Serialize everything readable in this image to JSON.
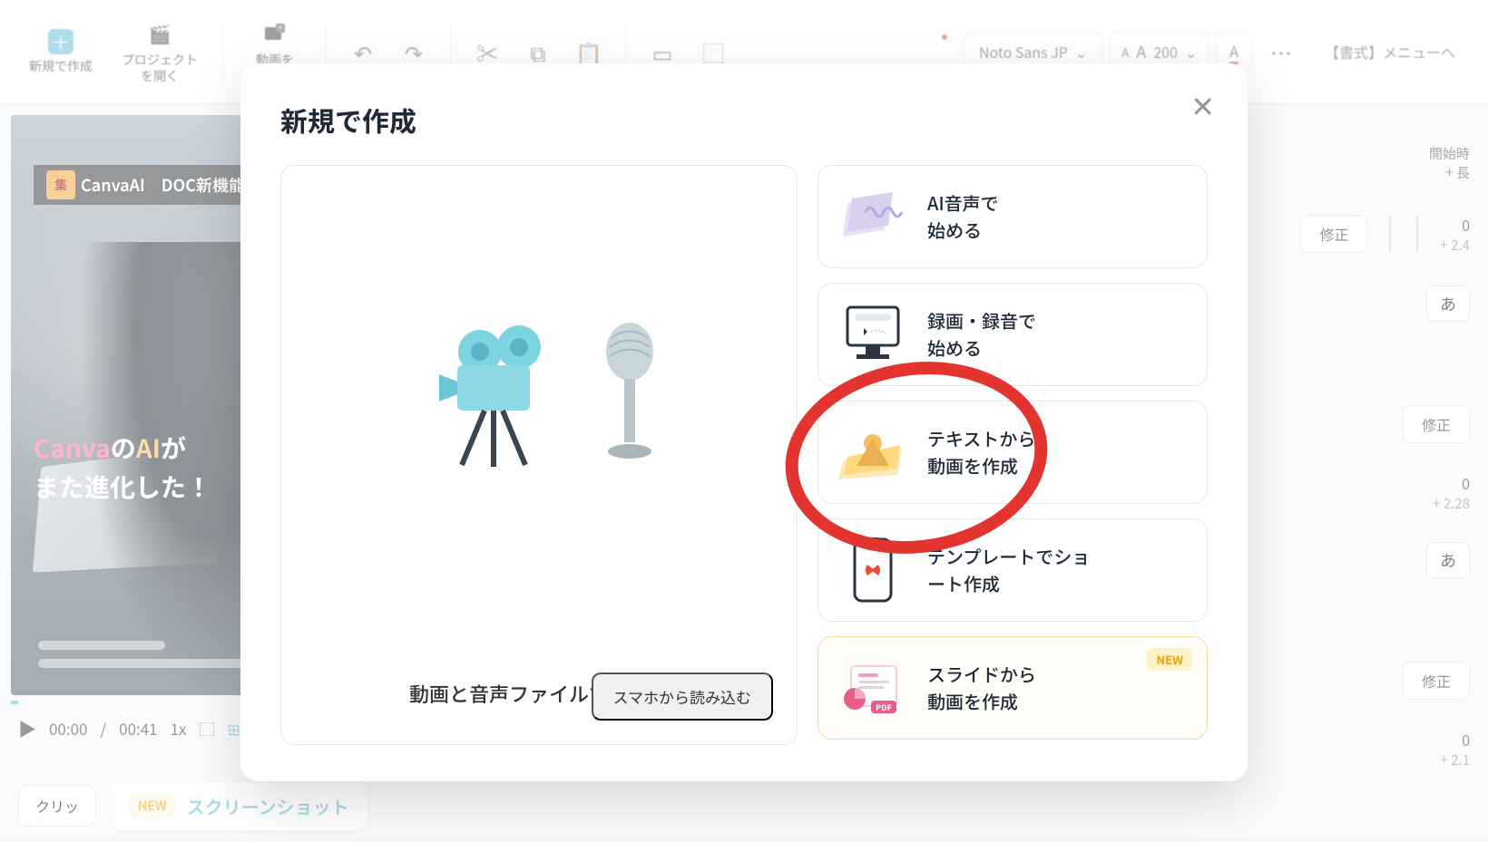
{
  "toolbar": {
    "new": "新規で作成",
    "open": "プロジェクト\nを開く",
    "add_video": "動画を\n追加する",
    "font_name": "Noto Sans JP",
    "font_size": "200",
    "format_menu": "【書式】メニューへ"
  },
  "preview": {
    "badge_title": "CanvaAI　DOC新機能",
    "caption_line1_a": "Canva",
    "caption_line1_b": "の",
    "caption_line1_c": "AI",
    "caption_line1_d": "が",
    "caption_line2": "また進化した！"
  },
  "playback": {
    "current": "00:00",
    "sep": "/",
    "total": "00:41",
    "speed": "1x"
  },
  "right": {
    "start_label": "開始時",
    "plus_long": "+ 長",
    "fix": "修正",
    "val0": "0",
    "val24": "+ 2.4",
    "val228": "+ 2.28",
    "val21": "+ 2.1",
    "a": "あ"
  },
  "bottom": {
    "clip": "クリッ",
    "new": "NEW",
    "screenshot": "スクリーンショット"
  },
  "modal": {
    "title": "新規で作成",
    "main_card": "動画と音声ファイルで始める",
    "import_phone": "スマホから読み込む",
    "options": [
      "AI音声で\n始める",
      "録画・録音で\n始める",
      "テキストから\n動画を作成",
      "テンプレートでショ\nート作成",
      "スライドから\n動画を作成"
    ],
    "new_tag": "NEW"
  }
}
